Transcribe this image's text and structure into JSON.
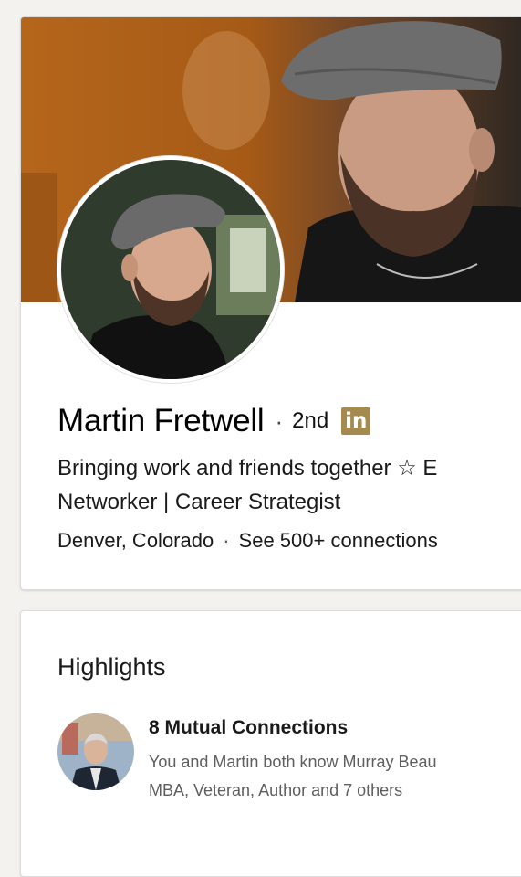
{
  "profile": {
    "name": "Martin Fretwell",
    "separator": "·",
    "degree": "2nd",
    "premium_badge": "in",
    "headline_line1": "Bringing work and friends together ☆ E",
    "headline_line2": "Networker | Career Strategist",
    "location": "Denver, Colorado",
    "meta_separator": "·",
    "connections_link": "See 500+ connections"
  },
  "highlights": {
    "title": "Highlights",
    "mutual_title": "8 Mutual Connections",
    "mutual_line1": "You and Martin both know Murray Beau",
    "mutual_line2": "MBA, Veteran, Author and 7 others"
  },
  "colors": {
    "banner": "#b2661a",
    "premium_badge": "#a48a4e",
    "background": "#f3f2ef"
  },
  "icons": {
    "premium": "linkedin-in-icon"
  }
}
